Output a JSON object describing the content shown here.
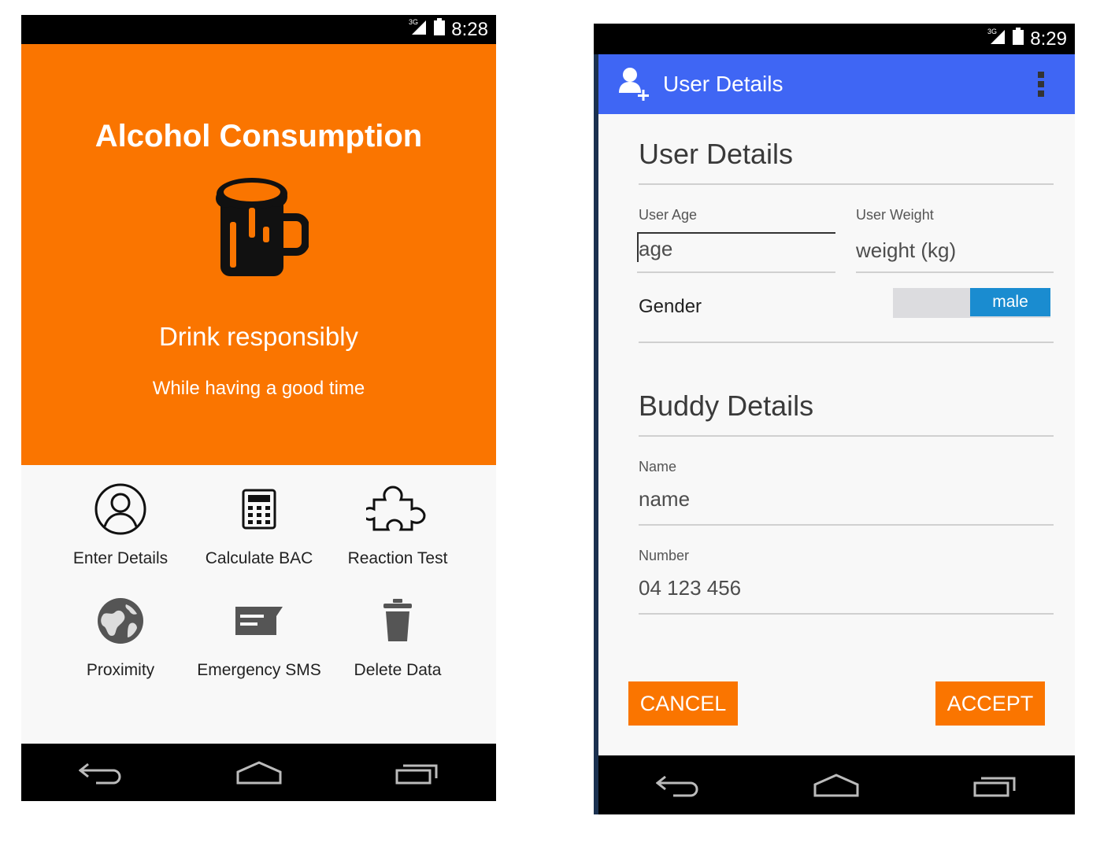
{
  "screen1": {
    "status": {
      "network": "3G",
      "time": "8:28"
    },
    "title": "Alcohol Consumption",
    "tagline": "Drink responsibly",
    "subtitle": "While having a good time",
    "menu": [
      {
        "label": "Enter Details",
        "icon": "user-circle-icon"
      },
      {
        "label": "Calculate BAC",
        "icon": "calculator-icon"
      },
      {
        "label": "Reaction Test",
        "icon": "puzzle-icon"
      },
      {
        "label": "Proximity",
        "icon": "globe-icon"
      },
      {
        "label": "Emergency SMS",
        "icon": "message-icon"
      },
      {
        "label": "Delete Data",
        "icon": "trash-icon"
      }
    ],
    "colors": {
      "accent": "#fa7500",
      "background": "#f8f8f8"
    }
  },
  "screen2": {
    "status": {
      "network": "3G",
      "time": "8:29"
    },
    "appbar": {
      "title": "User Details",
      "icon": "add-user-icon",
      "menu_icon": "overflow-menu-icon"
    },
    "user_section": {
      "title": "User Details",
      "age": {
        "label": "User Age",
        "placeholder": "age"
      },
      "weight": {
        "label": "User Weight",
        "placeholder": "weight (kg)"
      },
      "gender": {
        "label": "Gender",
        "value": "male"
      }
    },
    "buddy_section": {
      "title": "Buddy Details",
      "name": {
        "label": "Name",
        "placeholder": "name"
      },
      "number": {
        "label": "Number",
        "placeholder": "04 123 456"
      }
    },
    "buttons": {
      "cancel": "CANCEL",
      "accept": "ACCEPT"
    },
    "colors": {
      "appbar": "#3f66f4",
      "toggle": "#1a8cd0",
      "button": "#fa7500"
    }
  },
  "navbar": {
    "icons": [
      "back-icon",
      "home-icon",
      "recents-icon"
    ]
  }
}
